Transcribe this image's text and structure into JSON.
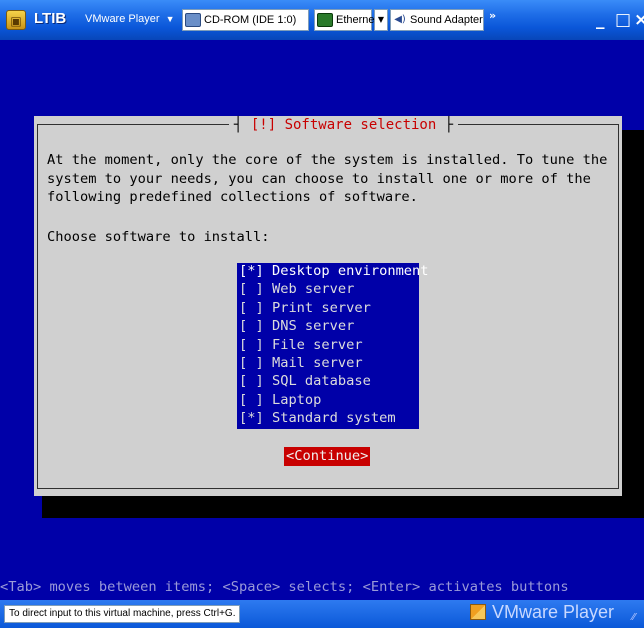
{
  "window": {
    "title": "LTIB",
    "player_menu": "VMware Player",
    "devices": {
      "cdrom": "CD-ROM (IDE 1:0)",
      "ethernet": "Ethernet",
      "sound": "Sound Adapter"
    },
    "more_glyph": "»",
    "min_glyph": "_",
    "max_glyph": "□",
    "close_glyph": "×"
  },
  "dialog": {
    "title": "[!] Software selection",
    "description": "At the moment, only the core of the system is installed. To tune the\nsystem to your needs, you can choose to install one or more of the\nfollowing predefined collections of software.",
    "prompt": "Choose software to install:",
    "items": [
      {
        "label": "[*] Desktop environment",
        "checked": true
      },
      {
        "label": "[ ] Web server",
        "checked": false
      },
      {
        "label": "[ ] Print server",
        "checked": false
      },
      {
        "label": "[ ] DNS server",
        "checked": false
      },
      {
        "label": "[ ] File server",
        "checked": false
      },
      {
        "label": "[ ] Mail server",
        "checked": false
      },
      {
        "label": "[ ] SQL database",
        "checked": false
      },
      {
        "label": "[ ] Laptop",
        "checked": false
      },
      {
        "label": "[*] Standard system",
        "checked": true
      }
    ],
    "continue_label": "<Continue>"
  },
  "help_line": "<Tab> moves between items; <Space> selects; <Enter> activates buttons",
  "statusbar": {
    "hint": "To direct input to this virtual machine, press Ctrl+G.",
    "logo_text": "VMware Player"
  },
  "colors": {
    "console_bg": "#0000a8",
    "dialog_bg": "#d0d0d0",
    "title_red": "#c80000",
    "button_red": "#c80000"
  }
}
